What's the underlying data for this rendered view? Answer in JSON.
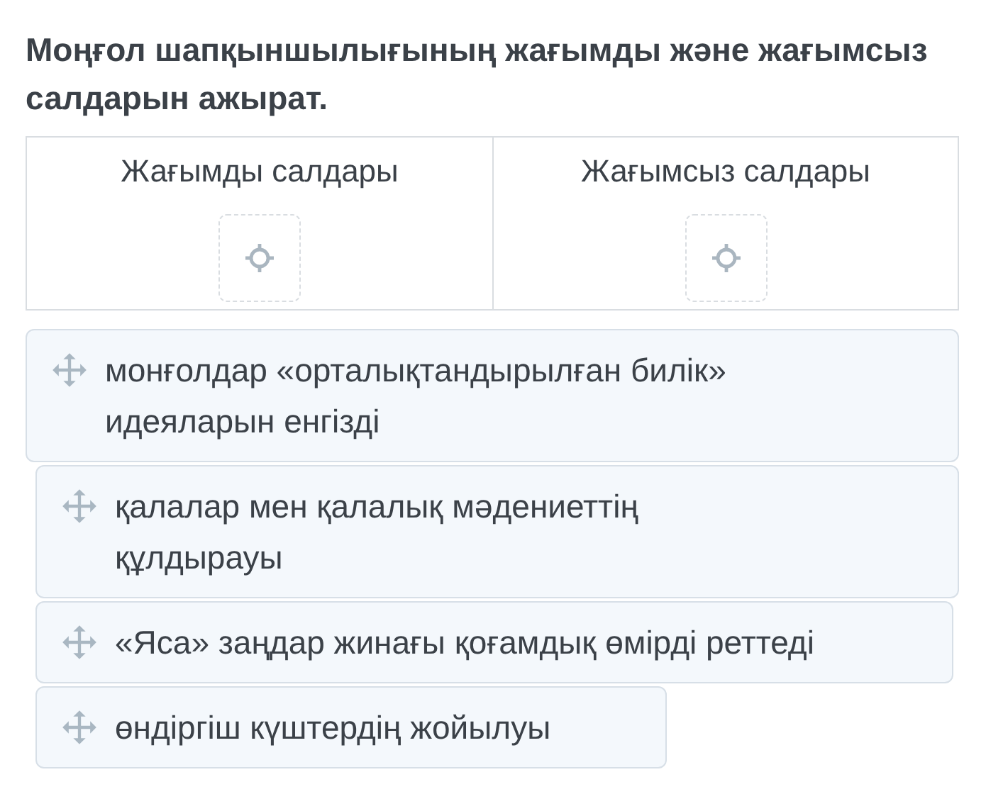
{
  "question": "Моңғол шапқыншылығының жағымды және жағымсыз салдарын ажырат.",
  "columns": [
    {
      "heading": "Жағымды салдары"
    },
    {
      "heading": "Жағымсыз салдары"
    }
  ],
  "cards": [
    {
      "text": "монғолдар «орталықтандырылған билік» идеяларын енгізді"
    },
    {
      "text": "қалалар мен қалалық мәдениеттің құлдырауы"
    },
    {
      "text": "«Яса» заңдар жинағы қоғамдық өмірді реттеді"
    },
    {
      "text": "өндіргіш күштердің жойылуы"
    }
  ]
}
